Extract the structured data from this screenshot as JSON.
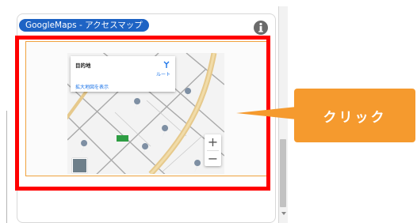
{
  "panel": {
    "badge_label": "GoogleMaps - アクセスマップ",
    "info_icon": "info-icon"
  },
  "map": {
    "popup": {
      "title": "目的地",
      "route_label": "ルート",
      "larger_map_link": "拡大地図を表示",
      "route_icon": "directions-icon"
    },
    "zoom_in_label": "+",
    "zoom_out_label": "−",
    "pegman_icon": "street-view-icon"
  },
  "annotation": {
    "callout_text": "クリック",
    "highlight_color": "#ff0000",
    "callout_color": "#f59a2e"
  },
  "colors": {
    "badge": "#1e63c4",
    "map_frame": "#f0a23e",
    "main_road": "#e6c98c",
    "pin": "#7e8fa3",
    "station": "#2e9d43"
  }
}
